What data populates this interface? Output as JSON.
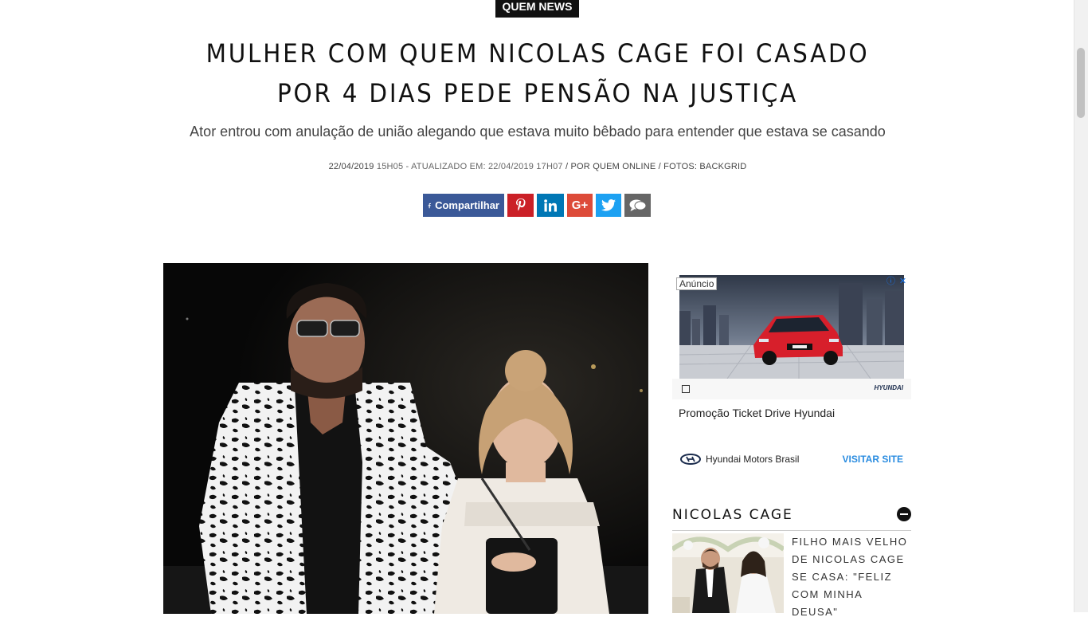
{
  "section": {
    "tag": "QUEM NEWS"
  },
  "article": {
    "headline": "MULHER COM QUEM NICOLAS CAGE FOI CASADO POR 4 DIAS PEDE PENSÃO NA JUSTIÇA",
    "subtitle": "Ator entrou com anulação de união alegando que estava muito bêbado para entender que estava se casando",
    "meta": {
      "date": "22/04/2019",
      "time_updated": "15H05 - ATUALIZADO EM: 22/04/2019 17H07",
      "author": "/ POR QUEM ONLINE / FOTOS: BACKGRID"
    },
    "photo_alt": "Nicolas Cage e Erika Koike"
  },
  "share": {
    "facebook_label": "Compartilhar",
    "icons": [
      "facebook-icon",
      "pinterest-icon",
      "linkedin-icon",
      "google-plus-icon",
      "twitter-icon",
      "comment-icon"
    ],
    "colors": {
      "facebook": "#3b5998",
      "pinterest": "#cb2027",
      "linkedin": "#0077b5",
      "googleplus": "#dd4b39",
      "twitter": "#1da1f2",
      "comment": "#666666"
    }
  },
  "ad": {
    "label": "Anúncio",
    "title": "Promoção Ticket Drive Hyundai",
    "brand": "Hyundai Motors Brasil",
    "cta": "VISITAR SITE",
    "logo_text": "HYUNDAI"
  },
  "sidebar": {
    "topic_title": "NICOLAS CAGE",
    "related": [
      {
        "title": "FILHO MAIS VELHO DE NICOLAS CAGE SE CASA: \"FELIZ COM MINHA DEUSA\""
      }
    ]
  }
}
